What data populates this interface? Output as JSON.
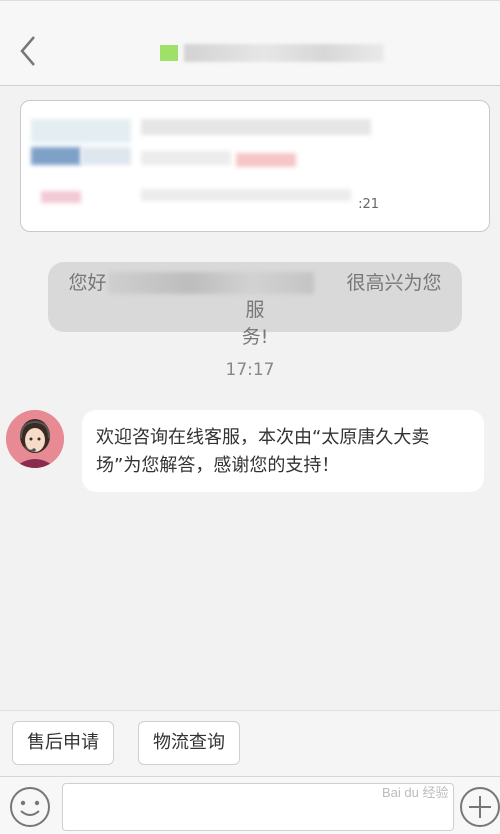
{
  "header": {
    "title": ""
  },
  "card": {
    "footer_text": ":21"
  },
  "system_message": {
    "line1_prefix": "您好",
    "line1_suffix": "很高兴为您服",
    "line2": "务!"
  },
  "timestamp": "17:17",
  "agent_message": {
    "text": "欢迎咨询在线客服，本次由“太原唐久大卖场”为您解答，感谢您的支持！"
  },
  "quick_replies": [
    {
      "label": "售后申请"
    },
    {
      "label": "物流查询"
    }
  ],
  "composer": {
    "value": "",
    "placeholder": ""
  },
  "watermark": "Bai du 经验",
  "colors": {
    "accent_green": "#9ee068",
    "avatar_bg": "#e88a93"
  },
  "icons": {
    "back": "chevron-left-icon",
    "emoji": "smiley-icon",
    "plus": "plus-circle-icon",
    "avatar": "support-agent-icon"
  }
}
